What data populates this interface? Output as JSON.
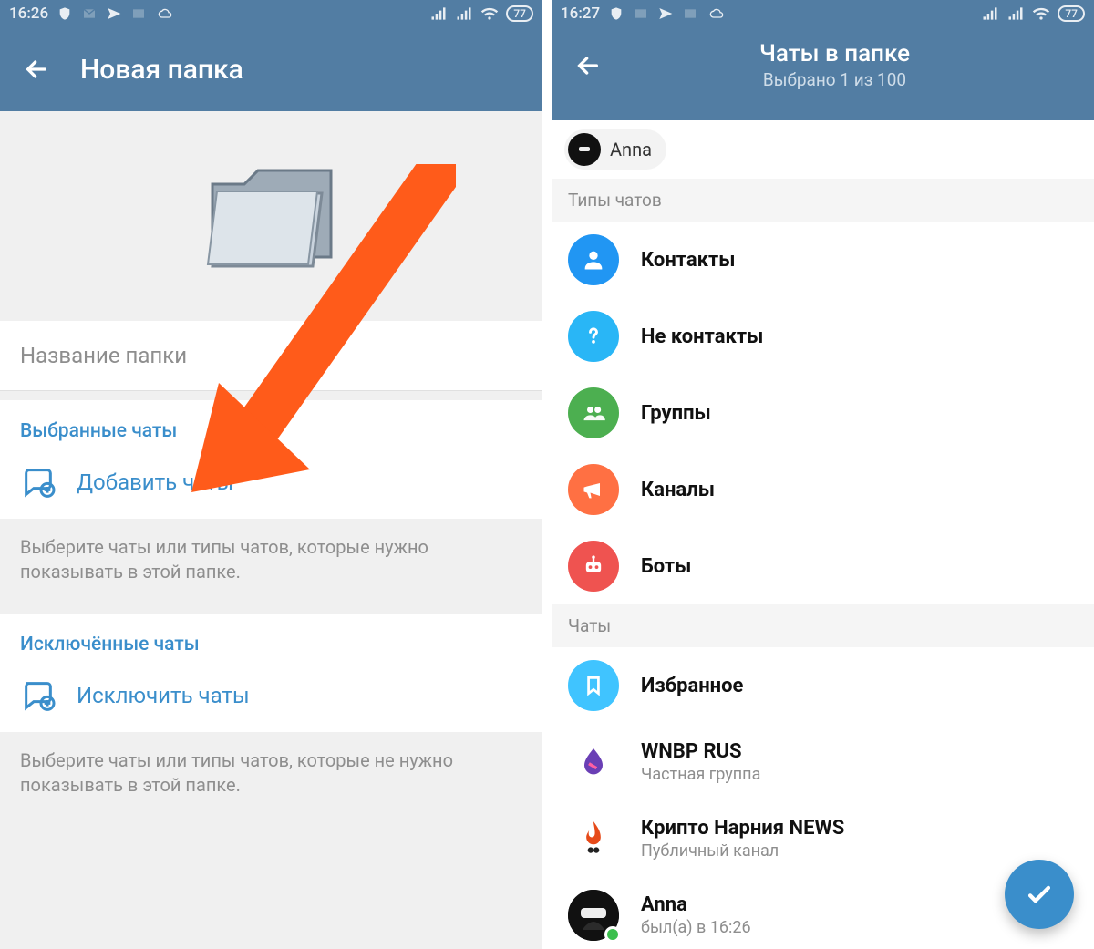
{
  "left": {
    "status": {
      "time": "16:26",
      "battery": "77"
    },
    "title": "Новая папка",
    "folder_name_placeholder": "Название папки",
    "selected": {
      "section_title": "Выбранные чаты",
      "action": "Добавить чаты",
      "hint": "Выберите чаты или типы чатов, которые нужно показывать в этой папке."
    },
    "excluded": {
      "section_title": "Исключённые чаты",
      "action": "Исключить чаты",
      "hint": "Выберите чаты или типы чатов, которые не нужно показывать в этой папке."
    }
  },
  "right": {
    "status": {
      "time": "16:27",
      "battery": "77"
    },
    "title": "Чаты в папке",
    "subtitle": "Выбрано 1 из 100",
    "chip": {
      "name": "Anna"
    },
    "section_types_label": "Типы чатов",
    "types": [
      {
        "label": "Контакты",
        "icon": "person",
        "color": "#2196f3"
      },
      {
        "label": "Не контакты",
        "icon": "question",
        "color": "#29b6f6"
      },
      {
        "label": "Группы",
        "icon": "group",
        "color": "#4caf50"
      },
      {
        "label": "Каналы",
        "icon": "megaphone",
        "color": "#ff7043"
      },
      {
        "label": "Боты",
        "icon": "robot",
        "color": "#ef5350"
      }
    ],
    "section_chats_label": "Чаты",
    "chats": [
      {
        "title": "Избранное",
        "subtitle": "",
        "avatar": "bookmark",
        "color": "#40c4ff"
      },
      {
        "title": "WNBP RUS",
        "subtitle": "Частная группа",
        "avatar": "drop",
        "color": "#ffffff"
      },
      {
        "title": "Крипто Нарния NEWS",
        "subtitle": "Публичный канал",
        "avatar": "flame",
        "color": "#ffffff"
      },
      {
        "title": "Anna",
        "subtitle": "был(а) в 16:26",
        "avatar": "anna",
        "color": "#111111",
        "online": true
      }
    ]
  }
}
